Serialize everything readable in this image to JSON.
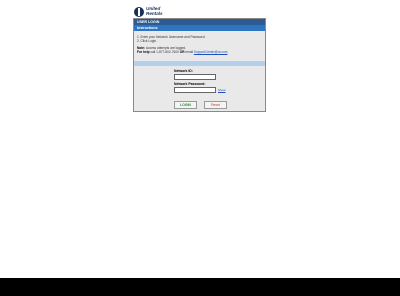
{
  "brand": {
    "line1": "United",
    "line2": "Rentals"
  },
  "panel": {
    "title": "USER LOGIN",
    "subtitle": "Instructions"
  },
  "instructions": {
    "step1": "1. Enter your Network Username and Password.",
    "step2": "2. Click Login.",
    "note_label": "Note:",
    "note_text": "Access attempts are logged.",
    "help_label": "For help",
    "help_text": "call 1-877-802-7600",
    "help_or_label": "OR",
    "help_email_prefix": "email",
    "help_email": "SupportCenter@ur.com"
  },
  "form": {
    "network_id_label": "Network ID:",
    "network_id_value": "",
    "password_label": "Network Password:",
    "password_value": "",
    "show_link": "Show",
    "login_button": "LOGIN",
    "reset_button": "Reset"
  },
  "colors": {
    "header": "#2c5a91",
    "subheader": "#2e74c0",
    "band": "#b5cfee",
    "panel_bg": "#e9e9e9"
  }
}
